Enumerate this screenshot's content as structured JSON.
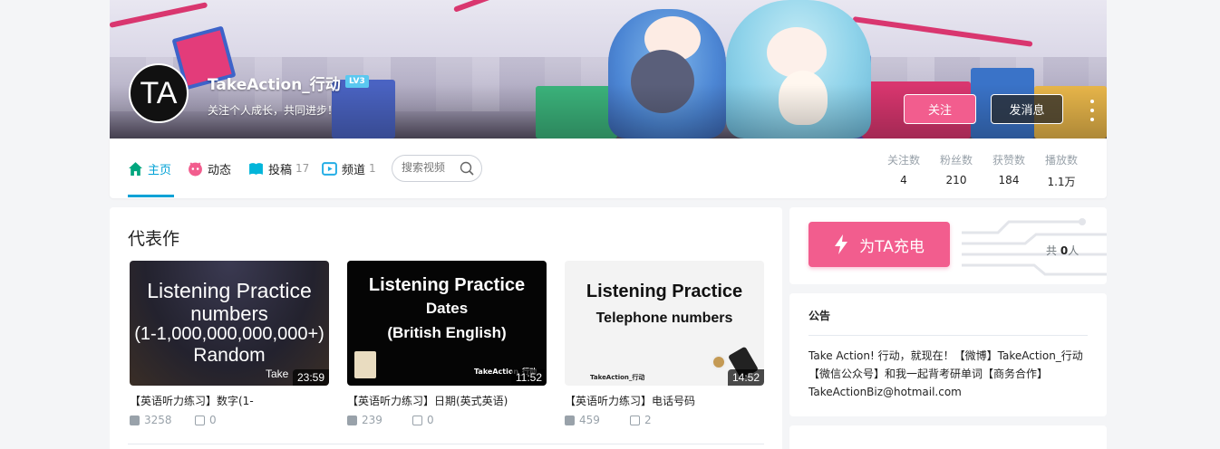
{
  "profile": {
    "avatar_text": "TA",
    "name": "TakeAction_行动",
    "level": "LV3",
    "signature": "关注个人成长，共同进步！",
    "follow_label": "关注",
    "message_label": "发消息"
  },
  "nav": {
    "items": [
      {
        "label": "主页",
        "icon": "home-icon",
        "count": ""
      },
      {
        "label": "动态",
        "icon": "dynamic-icon",
        "count": ""
      },
      {
        "label": "投稿",
        "icon": "upload-icon",
        "count": "17"
      },
      {
        "label": "频道",
        "icon": "channel-icon",
        "count": "1"
      }
    ],
    "search_placeholder": "搜索视频"
  },
  "stats": [
    {
      "label": "关注数",
      "value": "4"
    },
    {
      "label": "粉丝数",
      "value": "210"
    },
    {
      "label": "获赞数",
      "value": "184"
    },
    {
      "label": "播放数",
      "value": "1.1万"
    }
  ],
  "featured": {
    "title": "代表作",
    "videos": [
      {
        "thumb_lines": [
          "Listening Practice",
          "numbers",
          "(1-1,000,000,000,000+)",
          "Random"
        ],
        "thumb_watermark": "Take",
        "duration": "23:59",
        "title": "【英语听力练习】数字(1-",
        "plays": "3258",
        "danmaku": "0"
      },
      {
        "thumb_lines": [
          "Listening Practice",
          "Dates",
          "(British English)"
        ],
        "thumb_watermark": "TakeAction_行动",
        "duration": "11:52",
        "title": "【英语听力练习】日期(英式英语)",
        "plays": "239",
        "danmaku": "0"
      },
      {
        "thumb_lines": [
          "Listening Practice",
          "Telephone numbers"
        ],
        "thumb_watermark": "TakeAction_行动",
        "duration": "14:52",
        "title": "【英语听力练习】电话号码",
        "plays": "459",
        "danmaku": "2"
      }
    ]
  },
  "charge": {
    "button_label": "为TA充电",
    "count_prefix": "共",
    "count": "0",
    "count_suffix": "人"
  },
  "notice": {
    "title": "公告",
    "text": "Take Action! 行动，就现在！【微博】TakeAction_行动【微信公众号】和我一起背考研单词【商务合作】TakeActionBiz@hotmail.com"
  },
  "colors": {
    "accent_pink": "#f25d8e",
    "accent_blue": "#00a1d6"
  }
}
